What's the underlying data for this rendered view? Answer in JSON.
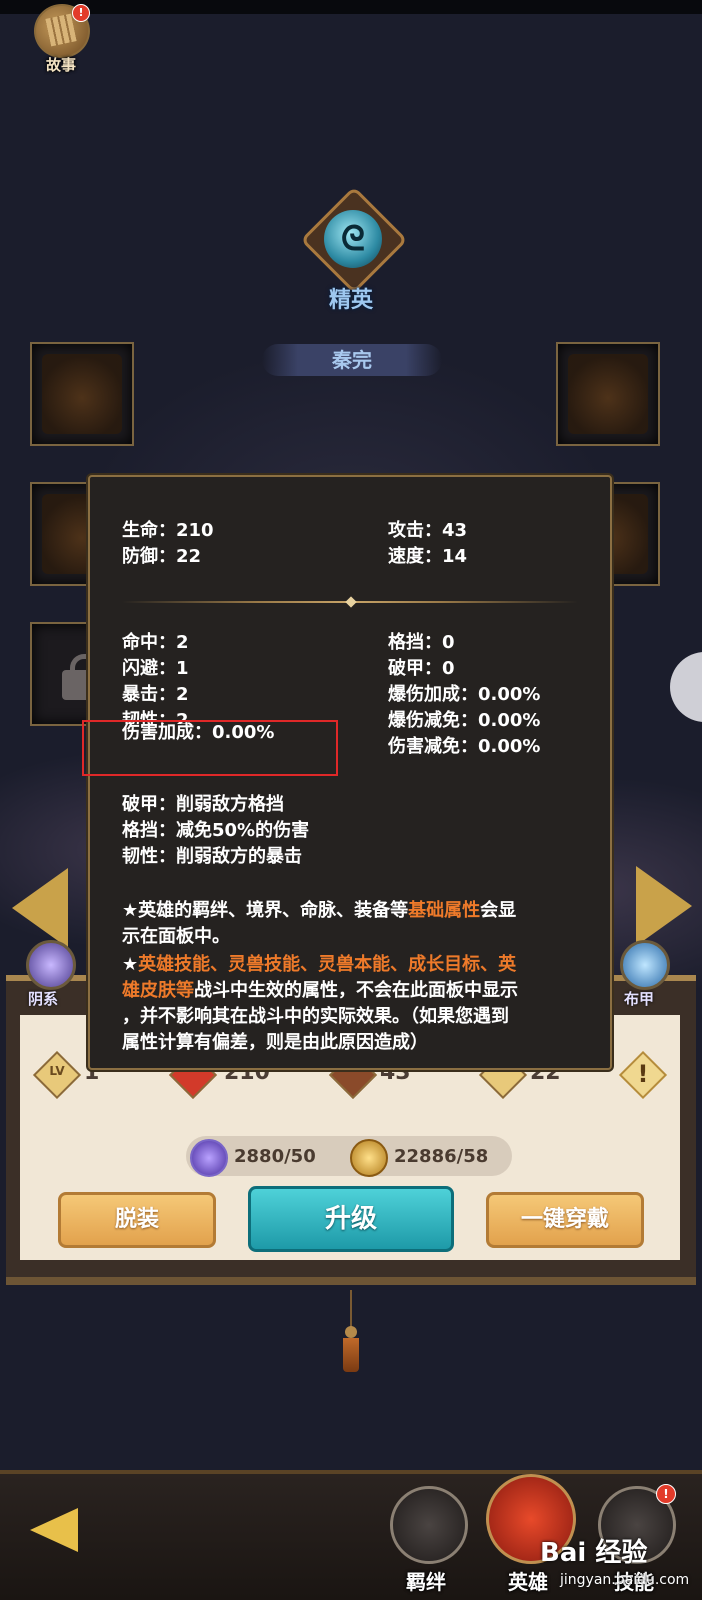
{
  "top_left": {
    "story_label": "故事",
    "story_badge": "!"
  },
  "hero": {
    "rank_label": "精英",
    "name": "秦完"
  },
  "stats_popup": {
    "base_stats": [
      {
        "label": "生命：",
        "value": "210"
      },
      {
        "label": "攻击：",
        "value": "43"
      },
      {
        "label": "防御：",
        "value": "22"
      },
      {
        "label": "速度：",
        "value": "14"
      }
    ],
    "advanced_stats_left": [
      {
        "label": "命中：",
        "value": "2"
      },
      {
        "label": "闪避：",
        "value": "1"
      },
      {
        "label": "暴击：",
        "value": "2"
      },
      {
        "label": "韧性：",
        "value": "2"
      },
      {
        "label": "伤害加成：",
        "value": "0.00%"
      }
    ],
    "advanced_stats_right": [
      {
        "label": "格挡：",
        "value": "0"
      },
      {
        "label": "破甲：",
        "value": "0"
      },
      {
        "label": "爆伤加成：",
        "value": "0.00%"
      },
      {
        "label": "爆伤减免：",
        "value": "0.00%"
      },
      {
        "label": "伤害减免：",
        "value": "0.00%"
      }
    ],
    "explanations": [
      "破甲：削弱敌方格挡",
      "格挡：减免50%的伤害",
      "韧性：削弱敌方的暴击"
    ],
    "note1_pre": "★英雄的羁绊、境界、命脉、装备等",
    "note1_highlight": "基础属性",
    "note1_post": "会显",
    "note1_line2": "示在面板中。",
    "note2_star": "★",
    "note2_highlight_line1": "英雄技能、灵兽技能、灵兽本能、成长目标、英",
    "note2_highlight_line2": "雄皮肤等",
    "note2_rest_line2": "战斗中生效的属性，不会在此面板中显示",
    "note2_line3": "，并不影响其在战斗中的实际效果。（如果您遇到",
    "note2_line4": "属性计算有偏差，则是由此原因造成）"
  },
  "side": {
    "left_label": "阴系",
    "right_label": "布甲"
  },
  "board": {
    "level_badge": "LV",
    "level_value": "1",
    "hp_value": "210",
    "atk_value": "43",
    "def_value": "22",
    "warn_icon": "!",
    "resource1": "2880/50",
    "resource2": "22886/58",
    "btn_unequip": "脱装",
    "btn_upgrade": "升级",
    "btn_equip_all": "一键穿戴"
  },
  "bottom_nav": [
    {
      "label": "羁绊"
    },
    {
      "label": "英雄"
    },
    {
      "label": "技能"
    }
  ],
  "bottom_nav_badge": "!",
  "watermark": {
    "logo": "Bai 经验",
    "url": "jingyan.baidu.com"
  },
  "colors": {
    "highlight_orange": "#ee7a2a",
    "panel_border": "#8b6f42",
    "upgrade_teal": "#1e9aa8",
    "red_box": "#e02828"
  }
}
